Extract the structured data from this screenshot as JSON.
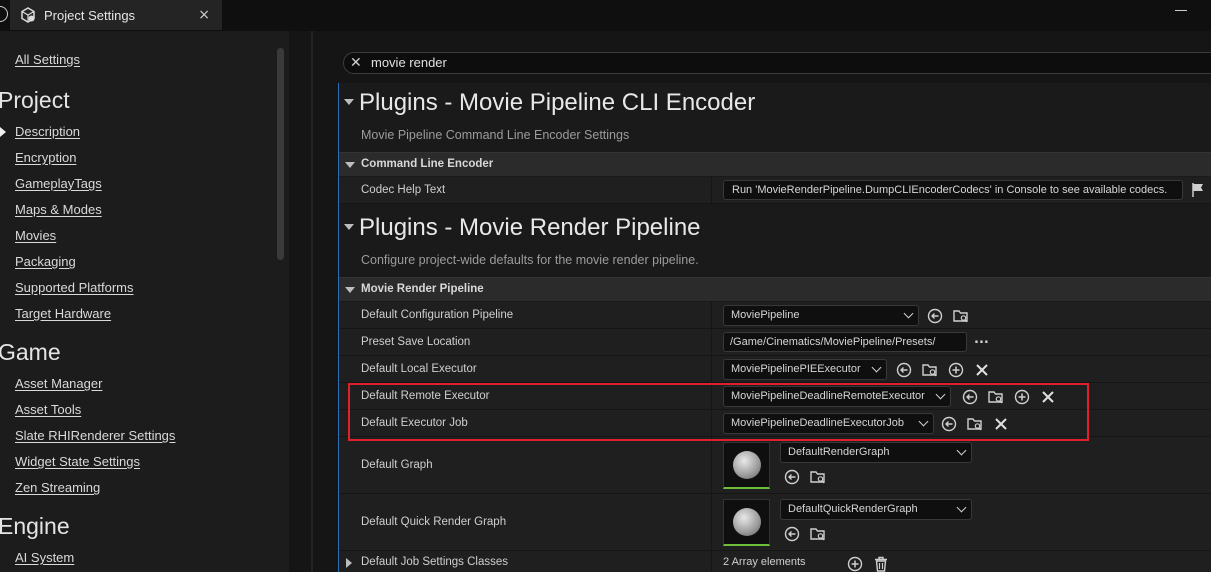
{
  "window": {
    "tab_title": "Project Settings",
    "tab_close": "×"
  },
  "sidebar": {
    "all_settings": "All Settings",
    "project_heading": "Project",
    "project_items": [
      "Description",
      "Encryption",
      "GameplayTags",
      "Maps & Modes",
      "Movies",
      "Packaging",
      "Supported Platforms",
      "Target Hardware"
    ],
    "game_heading": "Game",
    "game_items": [
      "Asset Manager",
      "Asset Tools",
      "Slate RHIRenderer Settings",
      "Widget State Settings",
      "Zen Streaming"
    ],
    "engine_heading": "Engine",
    "engine_items": [
      "AI System"
    ]
  },
  "search": {
    "value": "movie render",
    "clear_icon": "close-icon"
  },
  "sections": {
    "cli_encoder": {
      "title": "Plugins - Movie Pipeline CLI Encoder",
      "description": "Movie Pipeline Command Line Encoder Settings",
      "category": "Command Line Encoder",
      "codec_help_label": "Codec Help Text",
      "codec_help_value": "Run 'MovieRenderPipeline.DumpCLIEncoderCodecs' in Console to see available codecs."
    },
    "mrp": {
      "title": "Plugins - Movie Render Pipeline",
      "description": "Configure project-wide defaults for the movie render pipeline.",
      "category": "Movie Render Pipeline",
      "rows": {
        "config_pipeline": {
          "label": "Default Configuration Pipeline",
          "value": "MoviePipeline"
        },
        "preset_save": {
          "label": "Preset Save Location",
          "value": "/Game/Cinematics/MoviePipeline/Presets/",
          "more": "..."
        },
        "local_executor": {
          "label": "Default Local Executor",
          "value": "MoviePipelinePIEExecutor"
        },
        "remote_executor": {
          "label": "Default Remote Executor",
          "value": "MoviePipelineDeadlineRemoteExecutor"
        },
        "executor_job": {
          "label": "Default Executor Job",
          "value": "MoviePipelineDeadlineExecutorJob"
        },
        "graph": {
          "label": "Default Graph",
          "value": "DefaultRenderGraph"
        },
        "quick_graph": {
          "label": "Default Quick Render Graph",
          "value": "DefaultQuickRenderGraph"
        },
        "job_classes": {
          "label": "Default Job Settings Classes",
          "value": "2 Array elements"
        }
      }
    }
  },
  "colors": {
    "highlight": "#e0202a",
    "accent": "#2a6fb5",
    "thumb_border": "#6dbf3a"
  }
}
